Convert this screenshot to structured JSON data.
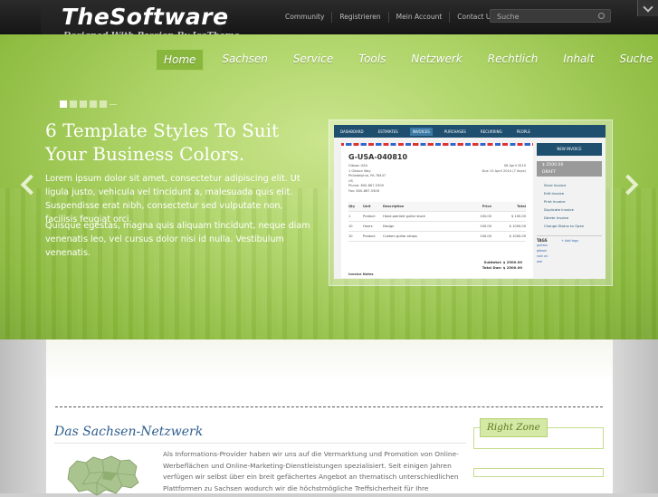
{
  "header": {
    "logo_title": "TheSoftware",
    "logo_tagline": "Designed With Passion By IceTheme",
    "top_links": [
      "Community",
      "Registrieren",
      "Mein Account",
      "Contact Us"
    ],
    "search_placeholder": "Suche"
  },
  "nav": {
    "items": [
      "Home",
      "Sachsen",
      "Service",
      "Tools",
      "Netzwerk",
      "Rechtlich",
      "Inhalt",
      "Suche"
    ],
    "active_index": 0
  },
  "slider": {
    "slide_count": 5,
    "active_slide": 1,
    "headline": "6 Template Styles To Suit Your Business Colors.",
    "paragraph1": "Lorem ipsum dolor sit amet, consectetur adipiscing elit. Ut ligula justo, vehicula vel tincidunt a, malesuada quis elit. Suspendisse erat nibh, consectetur sed vulputate non, facilisis feugiat orci.",
    "paragraph2": "Quisque egestas, magna quis aliquam tincidunt, neque diam venenatis leo, vel cursus dolor nisi id nulla. Vestibulum venenatis."
  },
  "invoice_preview": {
    "tabs": [
      "DASHBOARD",
      "ESTIMATES",
      "INVOICES",
      "PURCHASES",
      "RECURRING",
      "PEOPLE"
    ],
    "active_tab": "INVOICES",
    "invoice_id": "G-USA-040810",
    "address": [
      "Gibson USA",
      "1 Gibson Way",
      "Philadelphia, PA 76447",
      "US",
      "Phone: 800-867-5309",
      "Fax: 800-867-5308"
    ],
    "dates": [
      "08 April 2010",
      "Due 15 April 2010 (7 days)"
    ],
    "columns": [
      "Qty",
      "Unit",
      "Description",
      "Price",
      "Total"
    ],
    "rows": [
      [
        "1",
        "Product",
        "Hand-painted guitar stock",
        "100.00",
        "$ 100.00"
      ],
      [
        "10",
        "Hours",
        "Design",
        "100.00",
        "$ 1000.00"
      ],
      [
        "10",
        "Product",
        "Custom guitar straps",
        "100.00",
        "$ 1000.00"
      ]
    ],
    "subtotal_label": "Subtotal:",
    "subtotal": "$ 2500.00",
    "total_label": "Total Due:",
    "total": "$ 2500.00",
    "notes_label": "Invoice Notes",
    "new_invoice": "NEW INVOICE",
    "draft_amount": "$ 2500.00",
    "draft_label": "DRAFT",
    "actions": [
      "Send Invoice",
      "Edit Invoice",
      "Print Invoice",
      "Duplicate Invoice",
      "Delete Invoice",
      "Change Status to Open"
    ],
    "tags_label": "TAGS",
    "add_tags": "+ Add tags",
    "tags": [
      "guitars",
      "gibson",
      "rock on",
      "axe"
    ]
  },
  "content": {
    "section_title": "Das Sachsen-Netzwerk",
    "body": "Als Informations-Provider haben wir uns auf die Vermarktung und Promotion von Online-Werbeflächen und Online-Marketing-Dienstleistungen spezialisiert. Seit einigen Jahren verfügen wir selbst über ein breit gefächertes Angebot an thematisch unterschiedlichen Plattformen zu Sachsen wodurch wir die höchstmögliche Treffsicherheit für Ihre",
    "right_zone_title": "Right Zone"
  },
  "colors": {
    "accent_green": "#8cba3e",
    "title_blue": "#2d5e8e",
    "header_dark": "#1a1a1a"
  }
}
